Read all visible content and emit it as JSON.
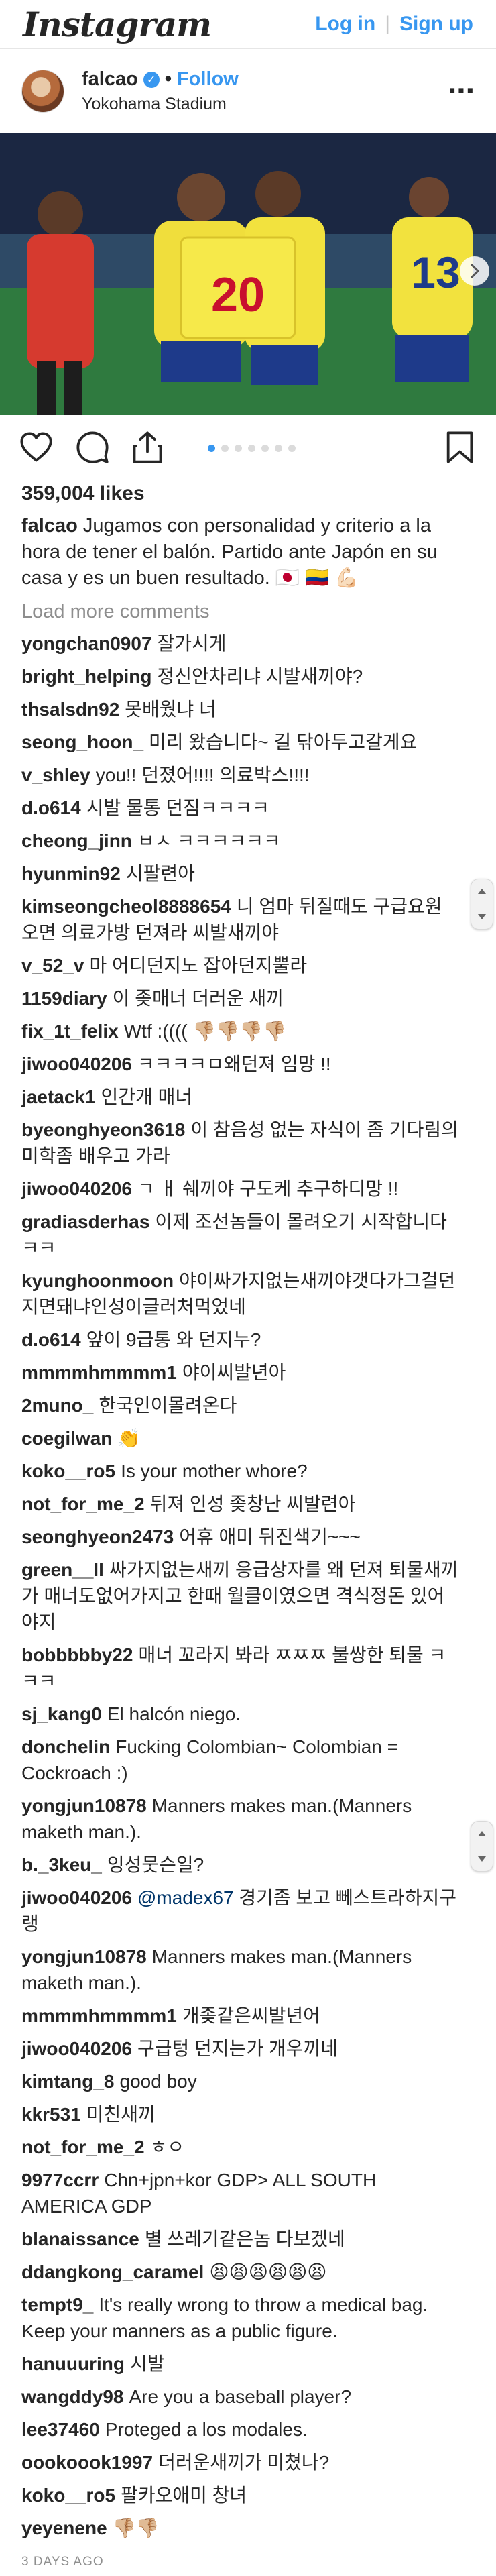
{
  "header": {
    "logo": "Instagram",
    "login": "Log in",
    "separator": "|",
    "signup": "Sign up"
  },
  "post": {
    "username": "falcao",
    "dot": "•",
    "follow": "Follow",
    "location": "Yokohama Stadium",
    "more": "•••",
    "jersey_number": "20",
    "teammate_number": "13",
    "carousel": {
      "total": 7,
      "active_index": 0
    },
    "likes": "359,004 likes",
    "caption_user": "falcao",
    "caption_text": "Jugamos con personalidad y criterio a la hora de tener el balón. Partido ante Japón en su casa y es un buen resultado. 🇯🇵 🇨🇴 💪🏻",
    "load_more": "Load more comments",
    "timestamp": "3 DAYS AGO"
  },
  "colors": {
    "link_blue": "#3897f0",
    "text": "#262626",
    "muted": "#8e8e8e",
    "mention": "#003569"
  },
  "comments": [
    {
      "user": "yongchan0907",
      "text": "잘가시게"
    },
    {
      "user": "bright_helping",
      "text": "정신안차리냐 시발새끼야?"
    },
    {
      "user": "thsalsdn92",
      "text": "못배웠냐 너"
    },
    {
      "user": "seong_hoon_",
      "text": "미리 왔습니다~ 길 닦아두고갈게요"
    },
    {
      "user": "v_shley",
      "text": "you!! 던졌어!!!! 의료박스!!!!"
    },
    {
      "user": "d.o614",
      "text": "시발 물통 던짐ㅋㅋㅋㅋ"
    },
    {
      "user": "cheong_jinn",
      "text": "ㅂㅅ ㅋㅋㅋㅋㅋㅋ"
    },
    {
      "user": "hyunmin92",
      "text": "시팔련아"
    },
    {
      "user": "kimseongcheol8888654",
      "text": "니 엄마 뒤질때도 구급요원 오면 의료가방 던져라 씨발새끼야"
    },
    {
      "user": "v_52_v",
      "text": "마 어디던지노 잡아던지뿔라"
    },
    {
      "user": "1159diary",
      "text": "이 좆매너 더러운 새끼"
    },
    {
      "user": "fix_1t_felix",
      "text": "Wtf :(((( 👎🏼👎🏼👎🏼👎🏼"
    },
    {
      "user": "jiwoo040206",
      "text": "ㅋㅋㅋㅋㅁ왜던져 임망 !!"
    },
    {
      "user": "jaetack1",
      "text": "인간개 매너"
    },
    {
      "user": "byeonghyeon3618",
      "text": "이 참음성 없는 자식이 좀 기다림의 미학좀 배우고 가라"
    },
    {
      "user": "jiwoo040206",
      "text": "ㄱ ㅐ 쉐끼야 구도케 추구하디망 !!"
    },
    {
      "user": "gradiasderhas",
      "text": "이제 조선놈들이 몰려오기 시작합니다ㅋㅋ"
    },
    {
      "user": "kyunghoonmoon",
      "text": "야이싸가지없는새끼야갯다가그걸던지면돼냐인성이글러처먹었네"
    },
    {
      "user": "d.o614",
      "text": "앞이 9급통 와 던지누?"
    },
    {
      "user": "mmmmhmmmm1",
      "text": "야이씨발년아"
    },
    {
      "user": "2muno_",
      "text": "한국인이몰려온다"
    },
    {
      "user": "coegilwan",
      "text": "👏"
    },
    {
      "user": "koko__ro5",
      "text": "Is your mother whore?"
    },
    {
      "user": "not_for_me_2",
      "text": "뒤져 인성 좆창난 씨발련아"
    },
    {
      "user": "seonghyeon2473",
      "text": "어휴 애미 뒤진색기~~~"
    },
    {
      "user": "green__ll",
      "text": "싸가지없는새끼 응급상자를 왜 던져 퇴물새끼가 매너도없어가지고 한때 월클이였으면 격식정돈 있어야지"
    },
    {
      "user": "bobbbbby22",
      "text": "매너 꼬라지 봐라 ㅉㅉㅉ 불쌍한 퇴물 ㅋㅋㅋ"
    },
    {
      "user": "sj_kang0",
      "text": "El halcón niego."
    },
    {
      "user": "donchelin",
      "text": "Fucking Colombian~ Colombian = Cockroach :)"
    },
    {
      "user": "yongjun10878",
      "text": "Manners makes man.(Manners maketh man.)."
    },
    {
      "user": "b._3keu_",
      "text": "잉성뭇슨일?"
    },
    {
      "user": "jiwoo040206",
      "mention": "@madex67",
      "text": "경기좀 보고 뻬스트라하지구랭"
    },
    {
      "user": "yongjun10878",
      "text": "Manners makes man.(Manners maketh man.)."
    },
    {
      "user": "mmmmhmmmm1",
      "text": "개좆같은씨발년어"
    },
    {
      "user": "jiwoo040206",
      "text": "구급텅 던지는가 개우끼네"
    },
    {
      "user": "kimtang_8",
      "text": "good boy"
    },
    {
      "user": "kkr531",
      "text": "미친새끼"
    },
    {
      "user": "not_for_me_2",
      "text": "ㅎㅇ"
    },
    {
      "user": "9977ccrr",
      "text": "Chn+jpn+kor GDP> ALL SOUTH AMERICA GDP"
    },
    {
      "user": "blanaissance",
      "text": "별 쓰레기같은놈 다보겠네"
    },
    {
      "user": "ddangkong_caramel",
      "text": "😫😫😫😫😫😫"
    },
    {
      "user": "tempt9_",
      "text": "It's really wrong to throw a medical bag. Keep your manners as a public figure."
    },
    {
      "user": "hanuuuring",
      "text": "시발"
    },
    {
      "user": "wangddy98",
      "text": "Are you a baseball player?"
    },
    {
      "user": "lee37460",
      "text": "Proteged a los modales."
    },
    {
      "user": "oookoook1997",
      "text": "더러운새끼가 미쳤나?"
    },
    {
      "user": "koko__ro5",
      "text": "팔카오애미 창녀"
    },
    {
      "user": "yeyenene",
      "text": "👎🏼👎🏼"
    }
  ]
}
